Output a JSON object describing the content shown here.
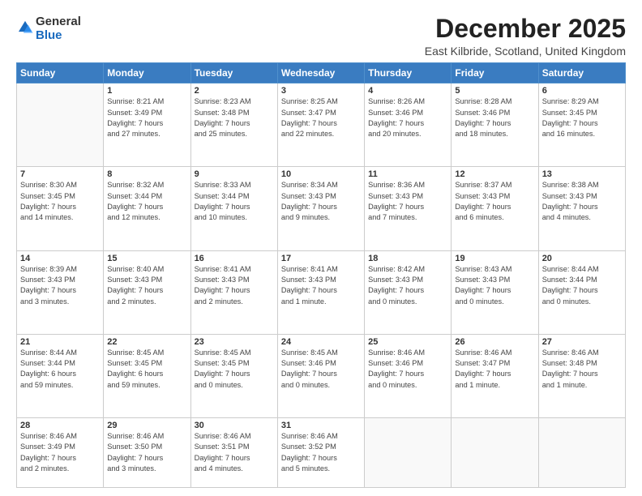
{
  "logo": {
    "general": "General",
    "blue": "Blue"
  },
  "title": "December 2025",
  "subtitle": "East Kilbride, Scotland, United Kingdom",
  "days_of_week": [
    "Sunday",
    "Monday",
    "Tuesday",
    "Wednesday",
    "Thursday",
    "Friday",
    "Saturday"
  ],
  "weeks": [
    [
      {
        "day": "",
        "info": ""
      },
      {
        "day": "1",
        "info": "Sunrise: 8:21 AM\nSunset: 3:49 PM\nDaylight: 7 hours\nand 27 minutes."
      },
      {
        "day": "2",
        "info": "Sunrise: 8:23 AM\nSunset: 3:48 PM\nDaylight: 7 hours\nand 25 minutes."
      },
      {
        "day": "3",
        "info": "Sunrise: 8:25 AM\nSunset: 3:47 PM\nDaylight: 7 hours\nand 22 minutes."
      },
      {
        "day": "4",
        "info": "Sunrise: 8:26 AM\nSunset: 3:46 PM\nDaylight: 7 hours\nand 20 minutes."
      },
      {
        "day": "5",
        "info": "Sunrise: 8:28 AM\nSunset: 3:46 PM\nDaylight: 7 hours\nand 18 minutes."
      },
      {
        "day": "6",
        "info": "Sunrise: 8:29 AM\nSunset: 3:45 PM\nDaylight: 7 hours\nand 16 minutes."
      }
    ],
    [
      {
        "day": "7",
        "info": "Sunrise: 8:30 AM\nSunset: 3:45 PM\nDaylight: 7 hours\nand 14 minutes."
      },
      {
        "day": "8",
        "info": "Sunrise: 8:32 AM\nSunset: 3:44 PM\nDaylight: 7 hours\nand 12 minutes."
      },
      {
        "day": "9",
        "info": "Sunrise: 8:33 AM\nSunset: 3:44 PM\nDaylight: 7 hours\nand 10 minutes."
      },
      {
        "day": "10",
        "info": "Sunrise: 8:34 AM\nSunset: 3:43 PM\nDaylight: 7 hours\nand 9 minutes."
      },
      {
        "day": "11",
        "info": "Sunrise: 8:36 AM\nSunset: 3:43 PM\nDaylight: 7 hours\nand 7 minutes."
      },
      {
        "day": "12",
        "info": "Sunrise: 8:37 AM\nSunset: 3:43 PM\nDaylight: 7 hours\nand 6 minutes."
      },
      {
        "day": "13",
        "info": "Sunrise: 8:38 AM\nSunset: 3:43 PM\nDaylight: 7 hours\nand 4 minutes."
      }
    ],
    [
      {
        "day": "14",
        "info": "Sunrise: 8:39 AM\nSunset: 3:43 PM\nDaylight: 7 hours\nand 3 minutes."
      },
      {
        "day": "15",
        "info": "Sunrise: 8:40 AM\nSunset: 3:43 PM\nDaylight: 7 hours\nand 2 minutes."
      },
      {
        "day": "16",
        "info": "Sunrise: 8:41 AM\nSunset: 3:43 PM\nDaylight: 7 hours\nand 2 minutes."
      },
      {
        "day": "17",
        "info": "Sunrise: 8:41 AM\nSunset: 3:43 PM\nDaylight: 7 hours\nand 1 minute."
      },
      {
        "day": "18",
        "info": "Sunrise: 8:42 AM\nSunset: 3:43 PM\nDaylight: 7 hours\nand 0 minutes."
      },
      {
        "day": "19",
        "info": "Sunrise: 8:43 AM\nSunset: 3:43 PM\nDaylight: 7 hours\nand 0 minutes."
      },
      {
        "day": "20",
        "info": "Sunrise: 8:44 AM\nSunset: 3:44 PM\nDaylight: 7 hours\nand 0 minutes."
      }
    ],
    [
      {
        "day": "21",
        "info": "Sunrise: 8:44 AM\nSunset: 3:44 PM\nDaylight: 6 hours\nand 59 minutes."
      },
      {
        "day": "22",
        "info": "Sunrise: 8:45 AM\nSunset: 3:45 PM\nDaylight: 6 hours\nand 59 minutes."
      },
      {
        "day": "23",
        "info": "Sunrise: 8:45 AM\nSunset: 3:45 PM\nDaylight: 7 hours\nand 0 minutes."
      },
      {
        "day": "24",
        "info": "Sunrise: 8:45 AM\nSunset: 3:46 PM\nDaylight: 7 hours\nand 0 minutes."
      },
      {
        "day": "25",
        "info": "Sunrise: 8:46 AM\nSunset: 3:46 PM\nDaylight: 7 hours\nand 0 minutes."
      },
      {
        "day": "26",
        "info": "Sunrise: 8:46 AM\nSunset: 3:47 PM\nDaylight: 7 hours\nand 1 minute."
      },
      {
        "day": "27",
        "info": "Sunrise: 8:46 AM\nSunset: 3:48 PM\nDaylight: 7 hours\nand 1 minute."
      }
    ],
    [
      {
        "day": "28",
        "info": "Sunrise: 8:46 AM\nSunset: 3:49 PM\nDaylight: 7 hours\nand 2 minutes."
      },
      {
        "day": "29",
        "info": "Sunrise: 8:46 AM\nSunset: 3:50 PM\nDaylight: 7 hours\nand 3 minutes."
      },
      {
        "day": "30",
        "info": "Sunrise: 8:46 AM\nSunset: 3:51 PM\nDaylight: 7 hours\nand 4 minutes."
      },
      {
        "day": "31",
        "info": "Sunrise: 8:46 AM\nSunset: 3:52 PM\nDaylight: 7 hours\nand 5 minutes."
      },
      {
        "day": "",
        "info": ""
      },
      {
        "day": "",
        "info": ""
      },
      {
        "day": "",
        "info": ""
      }
    ]
  ]
}
